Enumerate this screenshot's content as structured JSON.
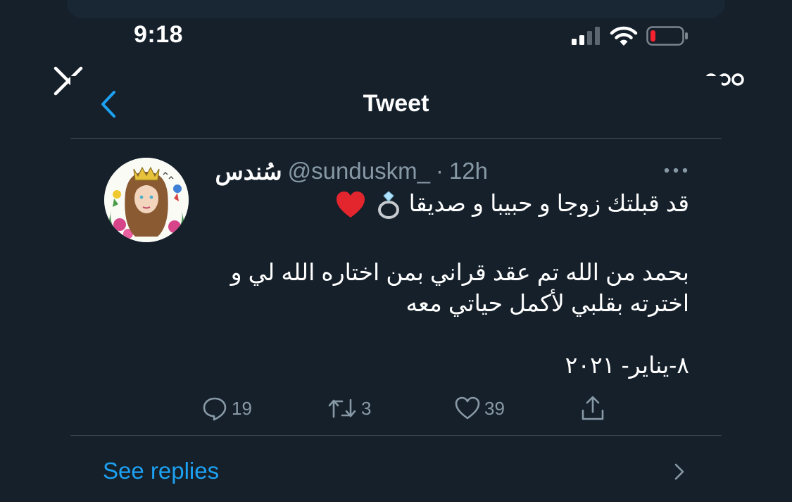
{
  "status_bar": {
    "time": "9:18"
  },
  "nav": {
    "title": "Tweet"
  },
  "tweet": {
    "author_name": "سُندس",
    "handle": "@sunduskm_",
    "separator": "·",
    "time": "12h",
    "line1": "قد قبلتك زوجا و حبيبا و صديقا",
    "line2": "بحمد من الله تم عقد قراني بمن اختاره الله لي و",
    "line3": "اخترته بقلبي لأكمل حياتي معه",
    "line4": "٨-يناير- ٢٠٢١"
  },
  "actions": {
    "replies": "19",
    "retweets": "3",
    "likes": "39"
  },
  "footer": {
    "see_replies": "See replies"
  },
  "colors": {
    "background": "#15202b",
    "secondary_text": "#8899a6",
    "accent": "#1da1f2",
    "divider": "#38444d",
    "battery_low": "#f4212e"
  },
  "icons": [
    "close-icon",
    "more-icon",
    "back-icon",
    "caret-icon",
    "reply-icon",
    "retweet-icon",
    "like-icon",
    "share-icon",
    "chevron-right-icon",
    "ring-emoji",
    "heart-emoji"
  ]
}
